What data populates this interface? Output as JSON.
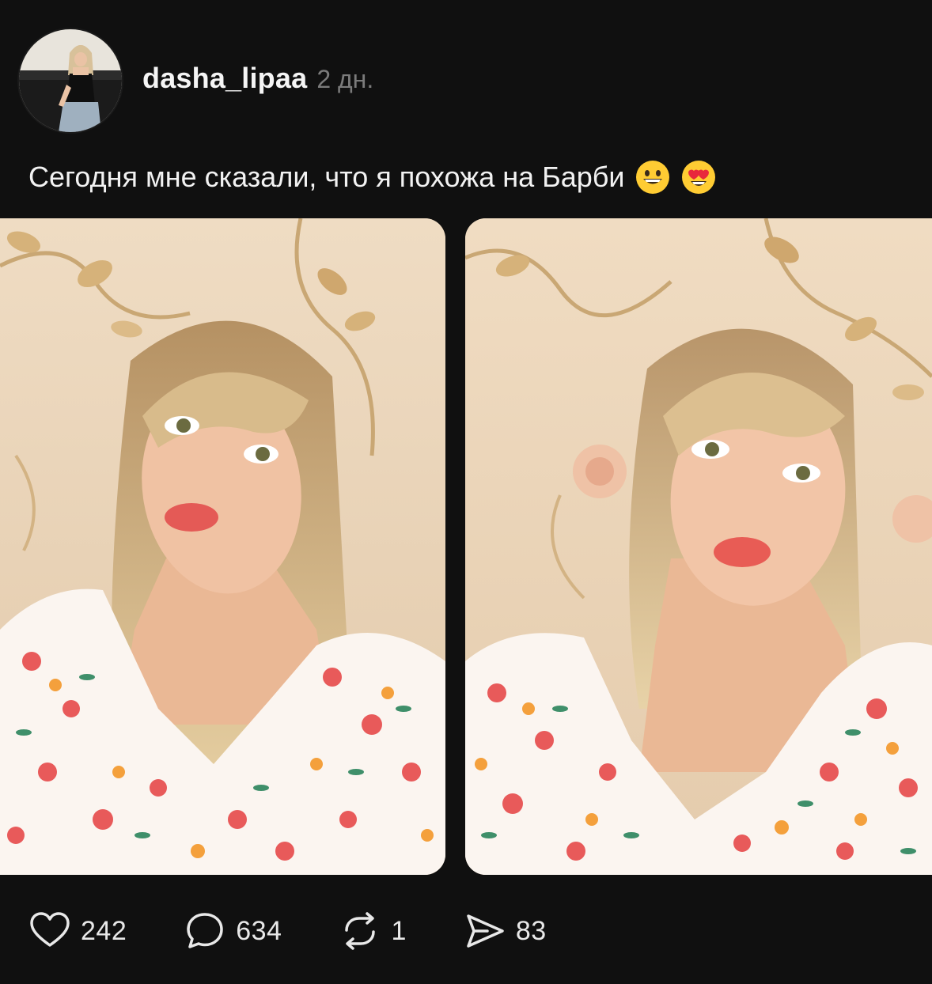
{
  "post": {
    "username": "dasha_lipaa",
    "timestamp": "2 дн.",
    "caption_text": "Сегодня мне сказали, что я похожа на Барби",
    "caption_emojis": [
      "grinning-face-icon",
      "heart-eyes-face-icon"
    ]
  },
  "media": [
    {
      "description_icon": "photo-1"
    },
    {
      "description_icon": "photo-2"
    }
  ],
  "actions": {
    "like": {
      "icon": "heart-icon",
      "count": "242"
    },
    "comment": {
      "icon": "comment-bubble-icon",
      "count": "634"
    },
    "repost": {
      "icon": "repost-icon",
      "count": "1"
    },
    "share": {
      "icon": "send-icon",
      "count": "83"
    }
  },
  "colors": {
    "background": "#101010",
    "text_primary": "#f5f5f5",
    "text_secondary": "#7b7b7b"
  }
}
